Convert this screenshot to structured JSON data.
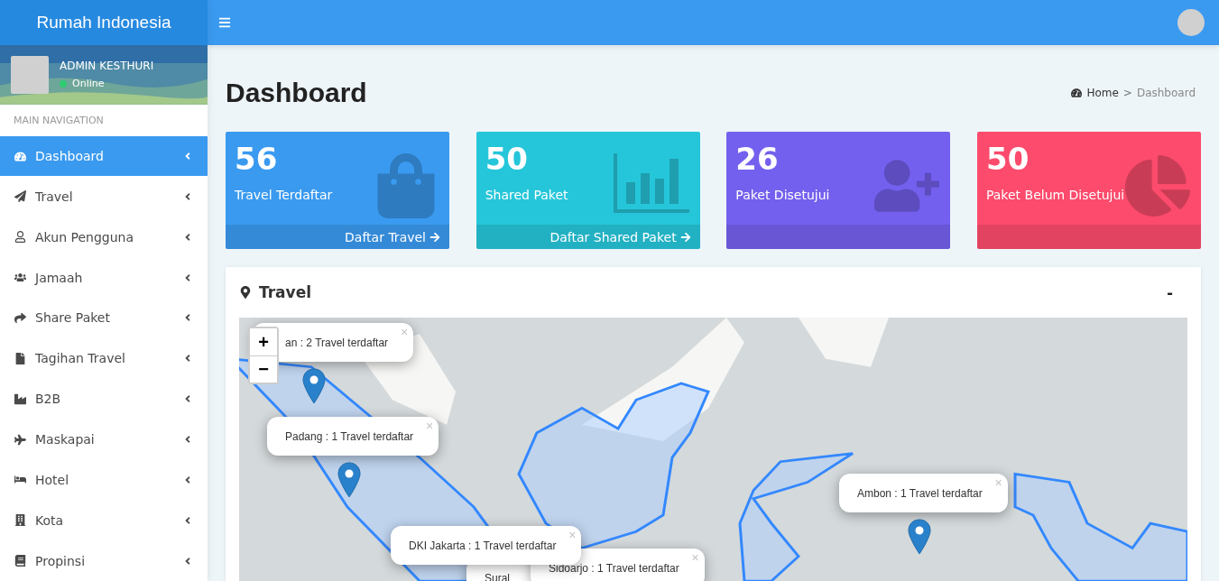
{
  "brand": "Rumah Indonesia",
  "user": {
    "name": "ADMIN KESTHURI",
    "status": "Online"
  },
  "nav_header": "MAIN NAVIGATION",
  "nav": [
    {
      "label": "Dashboard",
      "selected": true
    },
    {
      "label": "Travel",
      "selected": false
    },
    {
      "label": "Akun Pengguna",
      "selected": false
    },
    {
      "label": "Jamaah",
      "selected": false
    },
    {
      "label": "Share Paket",
      "selected": false
    },
    {
      "label": "Tagihan Travel",
      "selected": false
    },
    {
      "label": "B2B",
      "selected": false
    },
    {
      "label": "Maskapai",
      "selected": false
    },
    {
      "label": "Hotel",
      "selected": false
    },
    {
      "label": "Kota",
      "selected": false
    },
    {
      "label": "Propinsi",
      "selected": false
    }
  ],
  "page_title": "Dashboard",
  "breadcrumb": {
    "home": "Home",
    "separator": ">",
    "current": "Dashboard"
  },
  "cards": [
    {
      "value": "56",
      "label": "Travel Terdaftar",
      "link": "Daftar Travel",
      "color": "#3a9af0"
    },
    {
      "value": "50",
      "label": "Shared Paket",
      "link": "Daftar Shared Paket",
      "color": "#26c6da"
    },
    {
      "value": "26",
      "label": "Paket Disetujui",
      "color": "#7460ee"
    },
    {
      "value": "50",
      "label": "Paket Belum Disetujui",
      "color": "#fc4b6c"
    }
  ],
  "panel": {
    "title": "Travel",
    "collapse": "-"
  },
  "map": {
    "zoom_in": "+",
    "zoom_out": "−",
    "popups": [
      {
        "text": "an : 2 Travel terdaftar",
        "close": "×"
      },
      {
        "text": "Padang : 1 Travel terdaftar",
        "close": "×"
      },
      {
        "text": "Sural"
      },
      {
        "text": "Sidoarjo : 1 Travel terdaftar",
        "close": "×"
      },
      {
        "text": "DKI Jakarta : 1 Travel terdaftar",
        "close": "×"
      },
      {
        "text": "Ambon : 1 Travel terdaftar",
        "close": "×"
      }
    ]
  }
}
